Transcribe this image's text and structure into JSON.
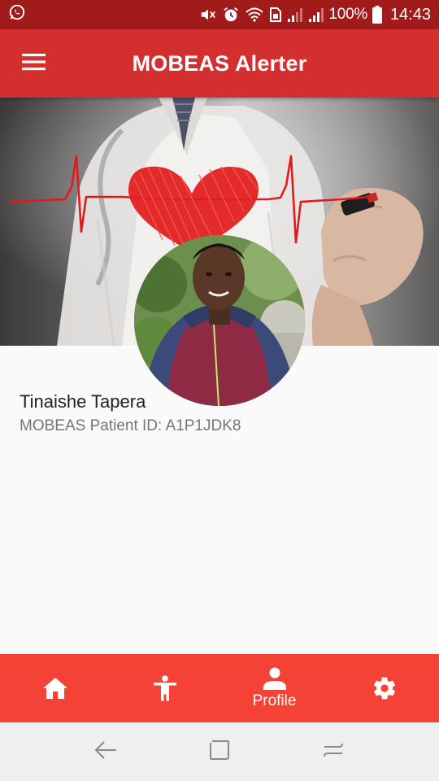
{
  "status_bar": {
    "battery": "100%",
    "time": "14:43",
    "left_icon": "whatsapp-icon",
    "right_icons": [
      "mute-icon",
      "alarm-icon",
      "wifi-icon",
      "sim-icon",
      "signal-1-icon",
      "signal-2-icon",
      "battery-icon"
    ]
  },
  "app_bar": {
    "title": "MOBEAS Alerter",
    "menu_icon": "menu-icon"
  },
  "header": {
    "image": "doctor-drawing-heart-image"
  },
  "profile": {
    "name": "Tinaishe Tapera",
    "patient_id": "MOBEAS Patient ID: A1P1JDK8",
    "avatar": "profile-photo"
  },
  "bottom_nav": {
    "items": [
      {
        "icon": "home-icon",
        "label": ""
      },
      {
        "icon": "accessibility-icon",
        "label": ""
      },
      {
        "icon": "person-icon",
        "label": "Profile"
      },
      {
        "icon": "settings-icon",
        "label": ""
      }
    ],
    "active": "Profile"
  },
  "system_nav": {
    "icons": [
      "back-icon",
      "home-square-icon",
      "recents-icon"
    ]
  },
  "colors": {
    "status_bar": "#a11b1b",
    "app_bar": "#d32f2f",
    "bottom_nav": "#f44336",
    "background": "#fafafa"
  }
}
